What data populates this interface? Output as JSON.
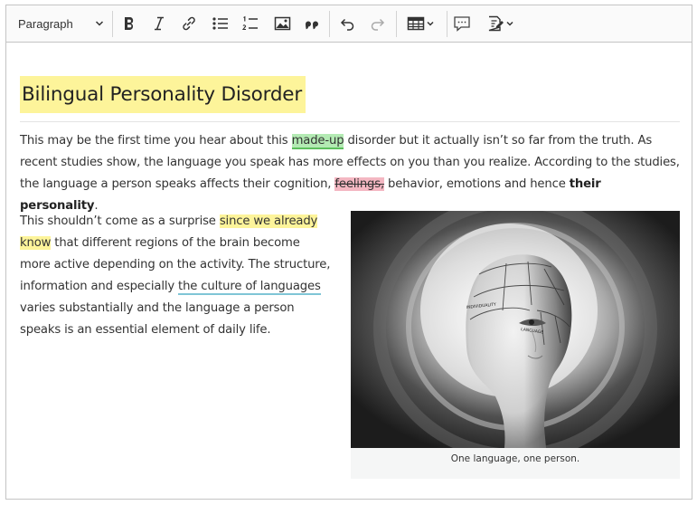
{
  "toolbar": {
    "paragraph_label": "Paragraph",
    "buttons": [
      "bold",
      "italic",
      "link",
      "bulleted-list",
      "numbered-list",
      "image",
      "blockquote",
      "undo",
      "redo",
      "table",
      "comment",
      "track-changes"
    ]
  },
  "document": {
    "title": "Bilingual Personality Disorder",
    "p1": {
      "t1": "This may be the first time you hear about this ",
      "mark_green": "made-up",
      "t2": " disorder but it actually isn’t so far from the truth. As recent studies show, the language you speak has more effects on you than you realize. According to the studies, the language a person speaks affects their cognition, ",
      "mark_red": "feelings,",
      "t3": " behavior, emotions and hence ",
      "bold": "their personality",
      "t4": "."
    },
    "p2": {
      "t1": "This shouldn’t come as a surprise ",
      "mark_yellow": "since we already know",
      "t2": " that different regions of the brain become more active depending on the activity. The structure, information and especially ",
      "mark_blue": "the culture of languages",
      "t3": " varies substantially and the language a person speaks is an essential element of daily life."
    },
    "figure": {
      "caption": "One language, one person.",
      "labels": [
        "INDIVIDUALITY",
        "LANGUAGE"
      ]
    }
  },
  "colors": {
    "highlight_yellow": "#fdf49a",
    "highlight_green": "#b3eab3",
    "highlight_red": "#f4b7c2",
    "underline_blue": "#7fc5d6"
  }
}
